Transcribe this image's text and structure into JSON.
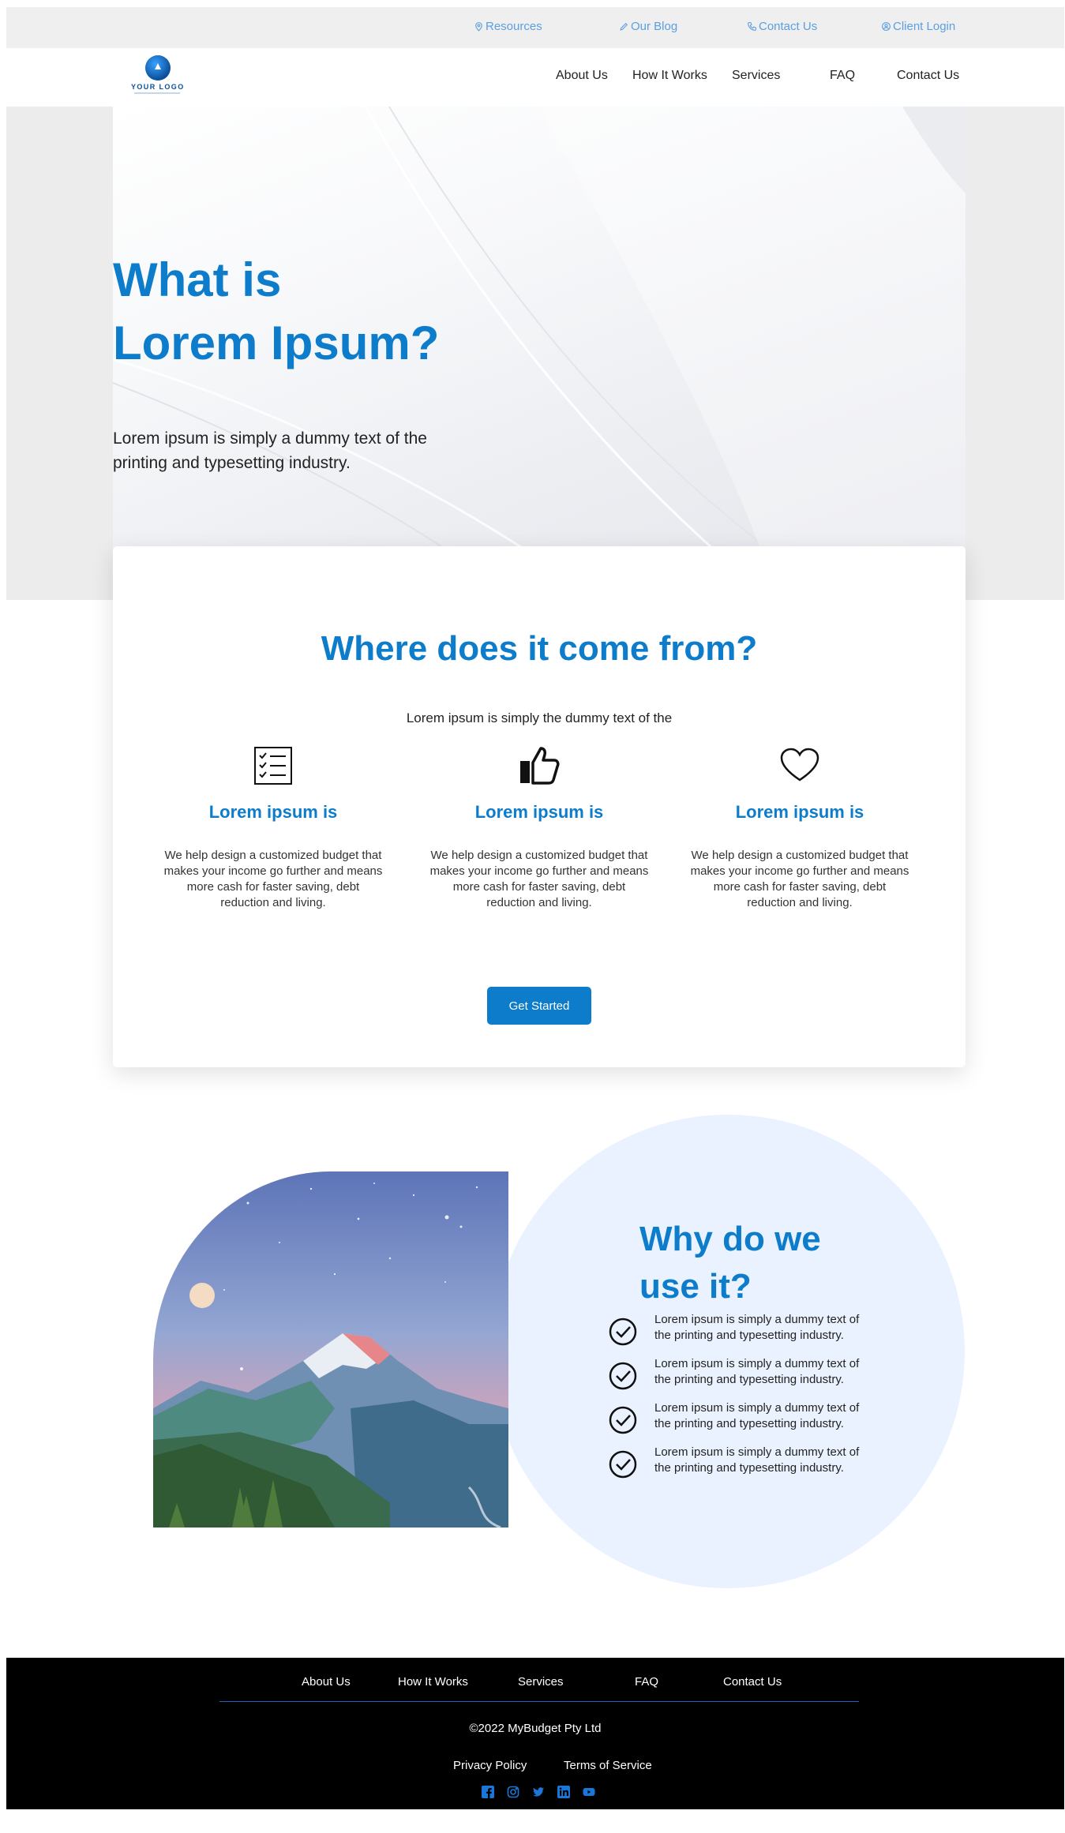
{
  "topbar": {
    "links": [
      {
        "label": "Resources",
        "icon": "location-pin-icon"
      },
      {
        "label": "Our Blog",
        "icon": "pencil-icon"
      },
      {
        "label": "Contact Us",
        "icon": "phone-icon"
      },
      {
        "label": "Client Login",
        "icon": "user-circle-icon"
      }
    ]
  },
  "nav": {
    "logo_text": "YOUR LOGO",
    "links": [
      "About Us",
      "How It Works",
      "Services",
      "FAQ",
      "Contact Us"
    ]
  },
  "hero": {
    "title_line1": "What is",
    "title_line2": "Lorem Ipsum?",
    "subtitle": "Lorem ipsum is simply a dummy text of the printing and typesetting industry."
  },
  "features_section": {
    "title": "Where does it come from?",
    "subtitle": "Lorem ipsum is simply the dummy text of the",
    "items": [
      {
        "icon": "checklist-icon",
        "title": "Lorem ipsum is",
        "text": "We help design a customized budget that makes your income go further and means more cash for faster saving, debt reduction and living."
      },
      {
        "icon": "thumbs-up-icon",
        "title": "Lorem ipsum is",
        "text": "We help design a customized budget that makes your income go further and means more cash for faster saving, debt reduction and living."
      },
      {
        "icon": "heart-icon",
        "title": "Lorem ipsum is",
        "text": "We help design a customized budget that makes your income go further and means more cash for faster saving, debt reduction and living."
      }
    ],
    "cta_label": "Get Started"
  },
  "why": {
    "title_line1": "Why do we",
    "title_line2": "use it?",
    "items": [
      "Lorem ipsum is simply a dummy text of the printing and typesetting industry.",
      "Lorem ipsum is simply a dummy text of the printing and typesetting industry.",
      "Lorem ipsum is simply a dummy text of the printing and typesetting industry.",
      "Lorem ipsum is simply a dummy text of the printing and typesetting industry."
    ]
  },
  "footer": {
    "links": [
      "About Us",
      "How It Works",
      "Services",
      "FAQ",
      "Contact Us"
    ],
    "copyright": "©2022 MyBudget Pty Ltd",
    "legal": [
      "Privacy Policy",
      "Terms of Service"
    ],
    "socials": [
      "facebook-icon",
      "instagram-icon",
      "twitter-icon",
      "linkedin-icon",
      "youtube-icon"
    ]
  },
  "colors": {
    "brand_blue": "#0c7ccb",
    "topbar_link": "#5a9fe0",
    "why_circle": "#eaf2ff",
    "footer_bg": "#000000"
  }
}
